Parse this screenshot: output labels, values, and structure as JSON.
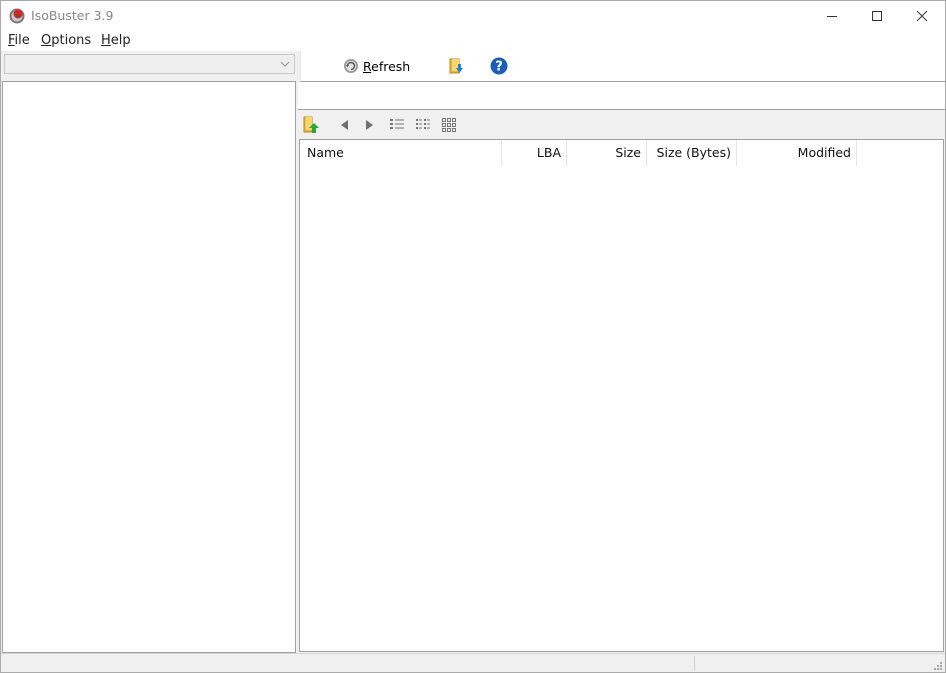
{
  "window": {
    "title": "IsoBuster 3.9"
  },
  "menu": [
    {
      "mnemonic": "F",
      "rest": "ile"
    },
    {
      "mnemonic": "O",
      "rest": "ptions"
    },
    {
      "mnemonic": "H",
      "rest": "elp"
    }
  ],
  "toolbar": {
    "refresh_mnemonic": "R",
    "refresh_rest": "efresh"
  },
  "list": {
    "columns": [
      "Name",
      "LBA",
      "Size",
      "Size (Bytes)",
      "Modified"
    ]
  },
  "colors": {
    "help_blue": "#1a5fb4",
    "folder_yellow": "#e8b73a",
    "accent_red": "#d9261c"
  },
  "icons": [
    "app-icon",
    "minimize-icon",
    "maximize-icon",
    "close-icon",
    "dropdown-arrow-icon",
    "refresh-icon",
    "extract-folder-icon",
    "help-icon",
    "folder-up-icon",
    "back-arrow-icon",
    "forward-arrow-icon",
    "details-view-icon",
    "list-view-icon",
    "icons-view-icon"
  ]
}
